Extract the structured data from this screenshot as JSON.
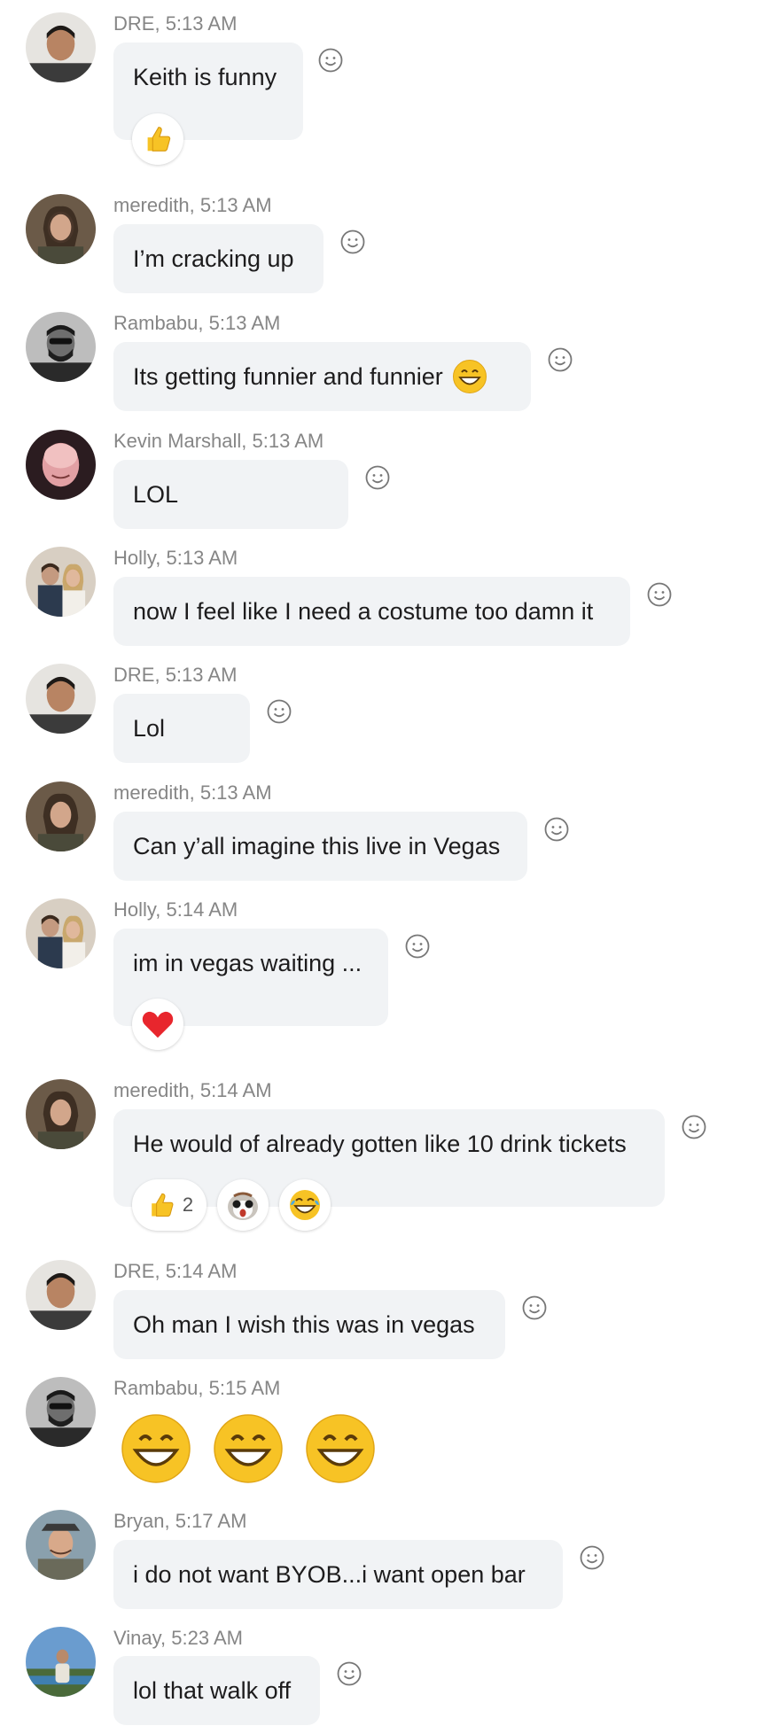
{
  "messages": [
    {
      "author": "DRE",
      "time": "5:13 AM",
      "text": "Keith is funny",
      "reactions": [
        {
          "icon": "thumbs-up-icon"
        }
      ]
    },
    {
      "author": "meredith",
      "time": "5:13 AM",
      "text": "I’m cracking up"
    },
    {
      "author": "Rambabu",
      "time": "5:13 AM",
      "text": "Its getting funnier and funnier",
      "inline_emoji": "grinning-face-icon"
    },
    {
      "author": "Kevin Marshall",
      "time": "5:13 AM",
      "text": "LOL"
    },
    {
      "author": "Holly",
      "time": "5:13 AM",
      "text": "now I feel like I need a costume too damn it"
    },
    {
      "author": "DRE",
      "time": "5:13 AM",
      "text": "Lol"
    },
    {
      "author": "meredith",
      "time": "5:13 AM",
      "text": "Can y’all imagine this live in Vegas"
    },
    {
      "author": "Holly",
      "time": "5:14 AM",
      "text": "im in vegas waiting ...",
      "reactions": [
        {
          "icon": "heart-icon"
        }
      ]
    },
    {
      "author": "meredith",
      "time": "5:14 AM",
      "text": "He would of already gotten like 10 drink tickets",
      "reactions": [
        {
          "icon": "thumbs-up-icon",
          "count": "2"
        },
        {
          "icon": "porg-icon"
        },
        {
          "icon": "laughing-tears-icon"
        }
      ]
    },
    {
      "author": "DRE",
      "time": "5:14 AM",
      "text": "Oh man I wish this was in vegas"
    },
    {
      "author": "Rambabu",
      "time": "5:15 AM",
      "emojis": [
        "grinning-face-icon",
        "grinning-face-icon",
        "grinning-face-icon"
      ]
    },
    {
      "author": "Bryan",
      "time": "5:17 AM",
      "text": "i do not want BYOB...i want open bar"
    },
    {
      "author": "Vinay",
      "time": "5:23 AM",
      "text": "lol that walk off"
    }
  ],
  "colors": {
    "bubble": "#f1f3f5",
    "meta": "#868686",
    "text": "#1d1c1d",
    "emoji_yellow": "#f7c325",
    "heart": "#e8262d"
  }
}
